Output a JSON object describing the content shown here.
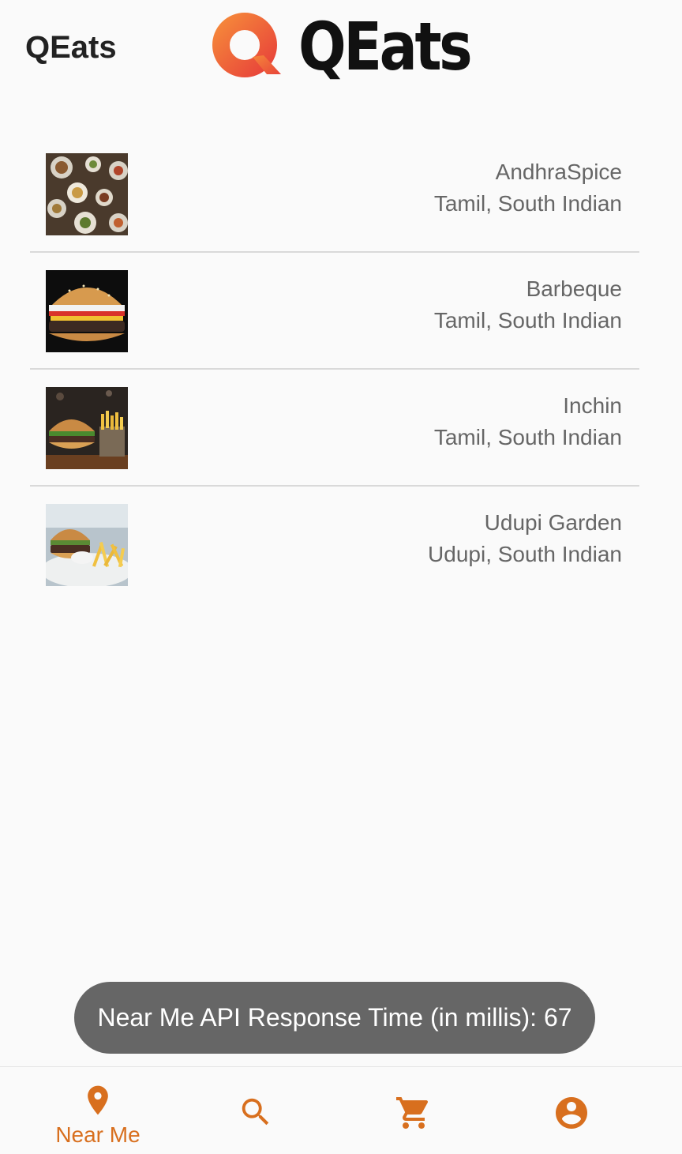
{
  "app_bar": {
    "title": "QEats",
    "logo_text": "QEats"
  },
  "restaurants": [
    {
      "name": "AndhraSpice",
      "cuisine": "Tamil, South Indian",
      "image": "dining-table-photo"
    },
    {
      "name": "Barbeque",
      "cuisine": "Tamil, South Indian",
      "image": "burger-photo"
    },
    {
      "name": "Inchin",
      "cuisine": "Tamil, South Indian",
      "image": "burger-fries-photo"
    },
    {
      "name": "Udupi Garden",
      "cuisine": "Udupi, South Indian",
      "image": "burger-plate-photo"
    }
  ],
  "toast": {
    "text": "Near Me API Response Time (in millis): 67"
  },
  "bottom_nav": [
    {
      "label": "Near Me",
      "icon": "location-pin-icon",
      "active": true
    },
    {
      "label": "",
      "icon": "search-icon",
      "active": false
    },
    {
      "label": "",
      "icon": "cart-icon",
      "active": false
    },
    {
      "label": "",
      "icon": "account-icon",
      "active": false
    }
  ],
  "colors": {
    "accent": "#d86f1e",
    "logo_orange": "#ee5b3a",
    "toast_bg": "#666666"
  }
}
